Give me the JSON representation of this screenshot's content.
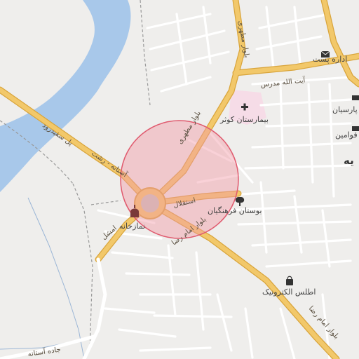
{
  "map": {
    "colors": {
      "land": "#efeeec",
      "water": "#a8c8ea",
      "major_road": "#f2c86a",
      "major_road_casing": "#d9a53c",
      "minor_road": "#ffffff",
      "hospital_area": "#f6dce7",
      "highlight_fill": "#f29aa6",
      "highlight_stroke": "#e05a6e",
      "rail": "#9a9a9a"
    },
    "roads": {
      "r1": "پل سفیدرود",
      "r2": "آستانه - رشت",
      "r3": "بلوار مطهری",
      "r4": "بلوار مطهری",
      "r5": "آیت الله مدرس",
      "r6": "استقلال",
      "r7": "بلوار امام رضا",
      "r8": "بلوار امام رضا",
      "r9": "امشل",
      "r10": "جاده آستانه"
    },
    "pois": {
      "p1": "بیمارستان کوثر",
      "p2": "اداره پست",
      "p3": "بوستان فرهنگیان",
      "p4": "اطلس الکترونیک",
      "p5": "نمازخانه",
      "p6": "پارسیان",
      "p7": "قوامین"
    },
    "place": "یه",
    "icons": {
      "hospital": "hospital-cross-icon",
      "post": "post-office-icon",
      "park": "park-tree-icon",
      "shop": "shopping-bag-icon",
      "mosque": "mosque-icon",
      "bank": "bank-icon"
    }
  }
}
